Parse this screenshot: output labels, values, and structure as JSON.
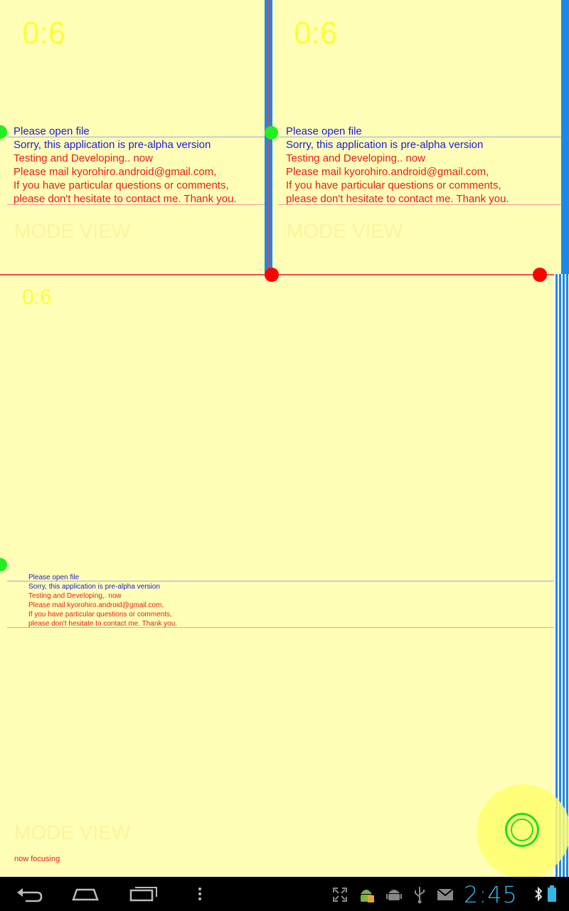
{
  "panes": [
    {
      "counter": "0:6",
      "lines": {
        "open_file": "Please open file",
        "sorry": "Sorry, this application is pre-alpha version",
        "testing": "Testing and Developing.. now",
        "mail": "Please mail kyorohiro.android@gmail.com,",
        "questions": "If you have particular questions or comments,",
        "contact": "please don't hesitate to contact me. Thank you."
      },
      "mode": "MODE VIEW"
    },
    {
      "counter": "0:6",
      "lines": {
        "open_file": "Please open file",
        "sorry": "Sorry, this application is pre-alpha version",
        "testing": "Testing and Developing.. now",
        "mail": "Please mail kyorohiro.android@gmail.com,",
        "questions": "If you have particular questions or comments,",
        "contact": "please don't hesitate to contact me. Thank you."
      },
      "mode": "MODE VIEW"
    },
    {
      "counter": "0:6",
      "lines": {
        "open_file": "Please open file",
        "sorry": "Sorry, this application is pre-alpha version",
        "testing": "Testing and Developing,. now",
        "mail": "Please mail kyorohiro.android@gmail.com,",
        "questions": "If you have particular questions or comments,",
        "contact": "please don't hesitate to contact me. Thank you."
      },
      "mode": "MODE VIEW",
      "status": "now focusing"
    }
  ],
  "colors": {
    "background": "#ffffb8",
    "divider_blue": "#1e88e5",
    "handle_red": "#ff0000",
    "handle_green": "#22ee22",
    "text_blue": "#1a1ad6",
    "text_red": "#e61c1c"
  },
  "system_bar": {
    "clock": "2:45",
    "nav_icons": [
      "back-icon",
      "home-icon",
      "recent-apps-icon",
      "menu-icon"
    ],
    "status_icons": [
      "fullscreen-icon",
      "android-debug-icon",
      "android-icon",
      "usb-icon",
      "gmail-icon",
      "bluetooth-icon",
      "battery-icon"
    ]
  }
}
